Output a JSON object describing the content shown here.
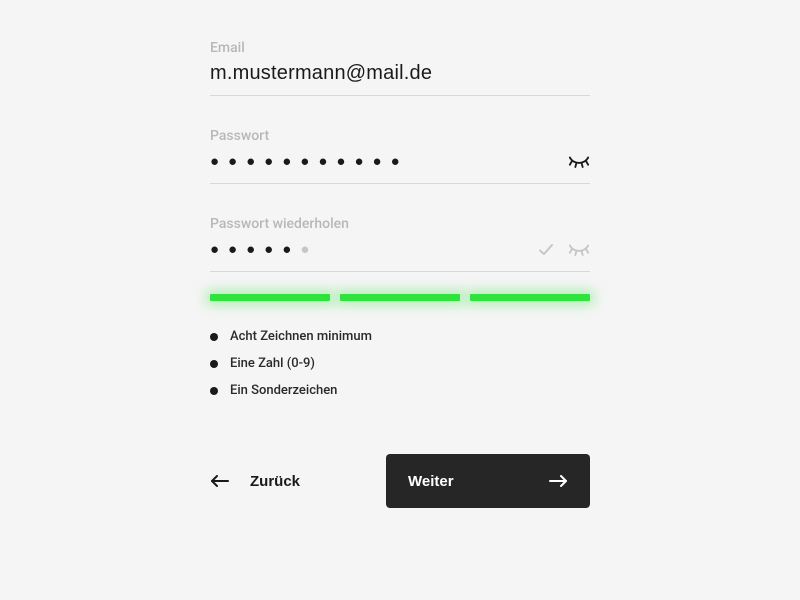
{
  "fields": {
    "email": {
      "label": "Email",
      "value": "m.mustermann@mail.de"
    },
    "password": {
      "label": "Passwort",
      "dotCount": 11,
      "dimDotCount": 0
    },
    "passwordRepeat": {
      "label": "Passwort wiederholen",
      "dotCount": 5,
      "dimDotCount": 1
    }
  },
  "strength": {
    "segments": 3,
    "color": "#2fe23d"
  },
  "requirements": [
    "Acht Zeichnen minimum",
    "Eine Zahl (0-9)",
    "Ein Sonderzeichen"
  ],
  "buttons": {
    "back": "Zurück",
    "next": "Weiter"
  }
}
